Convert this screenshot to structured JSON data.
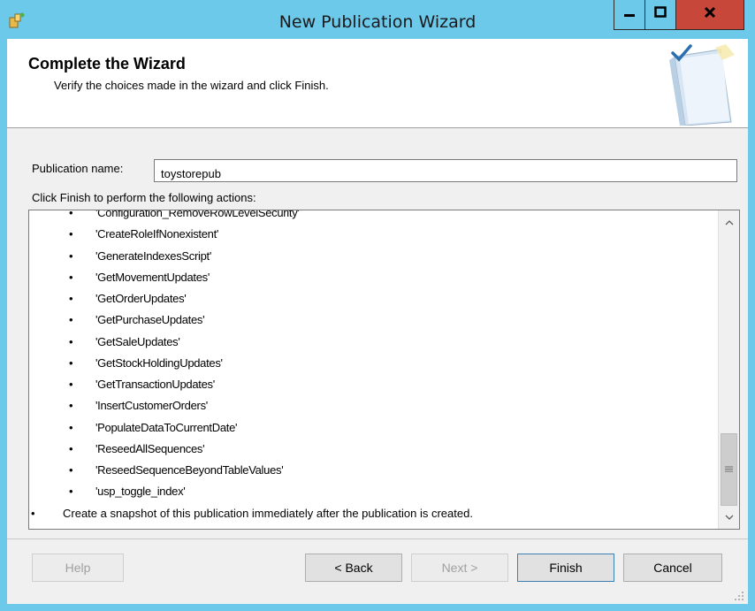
{
  "window": {
    "title": "New Publication Wizard",
    "accent_color": "#6cc9ea",
    "close_color": "#c7473a"
  },
  "header": {
    "title": "Complete the Wizard",
    "subtitle": "Verify the choices made in the wizard and click Finish."
  },
  "form": {
    "publication_label": "Publication name:",
    "publication_value": "toystorepub",
    "actions_label": "Click Finish to perform the following actions:"
  },
  "actions": [
    {
      "text": "'Configuration_RemoveRowLevelSecurity'",
      "level": 2
    },
    {
      "text": "'CreateRoleIfNonexistent'",
      "level": 2
    },
    {
      "text": "'GenerateIndexesScript'",
      "level": 2
    },
    {
      "text": "'GetMovementUpdates'",
      "level": 2
    },
    {
      "text": "'GetOrderUpdates'",
      "level": 2
    },
    {
      "text": "'GetPurchaseUpdates'",
      "level": 2
    },
    {
      "text": "'GetSaleUpdates'",
      "level": 2
    },
    {
      "text": "'GetStockHoldingUpdates'",
      "level": 2
    },
    {
      "text": "'GetTransactionUpdates'",
      "level": 2
    },
    {
      "text": "'InsertCustomerOrders'",
      "level": 2
    },
    {
      "text": "'PopulateDataToCurrentDate'",
      "level": 2
    },
    {
      "text": "'ReseedAllSequences'",
      "level": 2
    },
    {
      "text": "'ReseedSequenceBeyondTableValues'",
      "level": 2
    },
    {
      "text": "'usp_toggle_index'",
      "level": 2
    },
    {
      "text": "Create a snapshot of this publication immediately after the publication is created.",
      "level": 1
    }
  ],
  "scroll_position": 0.92,
  "buttons": {
    "help": "Help",
    "back": "< Back",
    "next": "Next >",
    "finish": "Finish",
    "cancel": "Cancel"
  },
  "icons": {
    "app": "wizard-app-icon",
    "header": "book-checkmark-icon"
  }
}
